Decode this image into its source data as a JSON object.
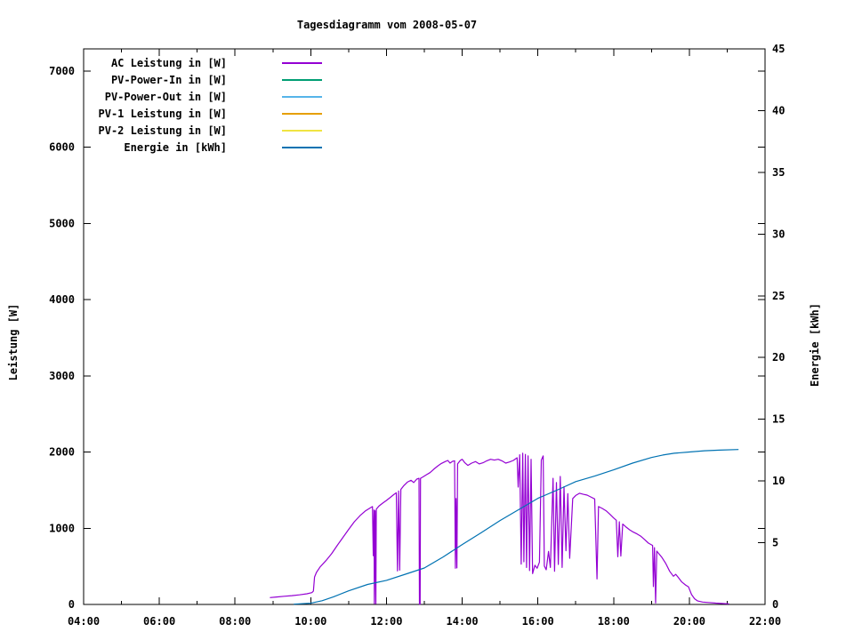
{
  "chart_data": {
    "type": "line",
    "title": "Tagesdiagramm vom 2008-05-07",
    "grid": false,
    "legend_position": "top-left",
    "x_axis": {
      "start_hour": 4,
      "end_hour": 22,
      "major_ticks": [
        {
          "hour": 4,
          "label": "04:00"
        },
        {
          "hour": 6,
          "label": "06:00"
        },
        {
          "hour": 8,
          "label": "08:00"
        },
        {
          "hour": 10,
          "label": "10:00"
        },
        {
          "hour": 12,
          "label": "12:00"
        },
        {
          "hour": 14,
          "label": "14:00"
        },
        {
          "hour": 16,
          "label": "16:00"
        },
        {
          "hour": 18,
          "label": "18:00"
        },
        {
          "hour": 20,
          "label": "20:00"
        },
        {
          "hour": 22,
          "label": "22:00"
        }
      ],
      "minor_tick_hours": [
        5,
        7,
        9,
        11,
        13,
        15,
        17,
        19,
        21
      ]
    },
    "y_left": {
      "label": "Leistung [W]",
      "ylim": [
        0,
        7292
      ],
      "tick_values": [
        0,
        1000,
        2000,
        3000,
        4000,
        5000,
        6000,
        7000
      ]
    },
    "y_right": {
      "label": "Energie [kWh]",
      "ylim": [
        0,
        45
      ],
      "tick_values": [
        0,
        5,
        10,
        15,
        20,
        25,
        30,
        35,
        40,
        45
      ]
    },
    "series": [
      {
        "name": "AC Leistung in [W]",
        "axis": "left",
        "color": "#9400d3",
        "points": [
          [
            8.92,
            90
          ],
          [
            9.1,
            98
          ],
          [
            9.3,
            107
          ],
          [
            9.5,
            116
          ],
          [
            9.7,
            126
          ],
          [
            9.9,
            140
          ],
          [
            10.03,
            155
          ],
          [
            10.07,
            175
          ],
          [
            10.1,
            360
          ],
          [
            10.15,
            420
          ],
          [
            10.25,
            495
          ],
          [
            10.4,
            575
          ],
          [
            10.55,
            665
          ],
          [
            10.7,
            775
          ],
          [
            10.85,
            880
          ],
          [
            11.0,
            985
          ],
          [
            11.15,
            1085
          ],
          [
            11.3,
            1165
          ],
          [
            11.45,
            1230
          ],
          [
            11.58,
            1270
          ],
          [
            11.63,
            1285
          ],
          [
            11.65,
            640
          ],
          [
            11.67,
            1240
          ],
          [
            11.68,
            10
          ],
          [
            11.7,
            1230
          ],
          [
            11.72,
            10
          ],
          [
            11.73,
            1250
          ],
          [
            11.8,
            1290
          ],
          [
            11.9,
            1330
          ],
          [
            12.0,
            1365
          ],
          [
            12.1,
            1405
          ],
          [
            12.2,
            1445
          ],
          [
            12.26,
            1465
          ],
          [
            12.29,
            440
          ],
          [
            12.32,
            1490
          ],
          [
            12.35,
            450
          ],
          [
            12.38,
            1510
          ],
          [
            12.45,
            1555
          ],
          [
            12.55,
            1605
          ],
          [
            12.65,
            1630
          ],
          [
            12.72,
            1600
          ],
          [
            12.8,
            1645
          ],
          [
            12.86,
            1655
          ],
          [
            12.87,
            5
          ],
          [
            12.89,
            5
          ],
          [
            12.9,
            1655
          ],
          [
            12.97,
            1675
          ],
          [
            13.05,
            1700
          ],
          [
            13.15,
            1730
          ],
          [
            13.25,
            1775
          ],
          [
            13.35,
            1815
          ],
          [
            13.45,
            1850
          ],
          [
            13.55,
            1875
          ],
          [
            13.62,
            1890
          ],
          [
            13.68,
            1855
          ],
          [
            13.75,
            1880
          ],
          [
            13.8,
            1885
          ],
          [
            13.82,
            475
          ],
          [
            13.84,
            1390
          ],
          [
            13.86,
            480
          ],
          [
            13.88,
            1845
          ],
          [
            13.95,
            1890
          ],
          [
            14.0,
            1905
          ],
          [
            14.07,
            1860
          ],
          [
            14.15,
            1825
          ],
          [
            14.25,
            1855
          ],
          [
            14.35,
            1875
          ],
          [
            14.45,
            1845
          ],
          [
            14.55,
            1860
          ],
          [
            14.65,
            1885
          ],
          [
            14.75,
            1905
          ],
          [
            14.85,
            1895
          ],
          [
            14.95,
            1905
          ],
          [
            15.05,
            1885
          ],
          [
            15.15,
            1855
          ],
          [
            15.25,
            1870
          ],
          [
            15.35,
            1890
          ],
          [
            15.45,
            1925
          ],
          [
            15.48,
            1540
          ],
          [
            15.52,
            1965
          ],
          [
            15.56,
            530
          ],
          [
            15.6,
            1985
          ],
          [
            15.63,
            560
          ],
          [
            15.67,
            1970
          ],
          [
            15.7,
            485
          ],
          [
            15.74,
            1950
          ],
          [
            15.78,
            445
          ],
          [
            15.82,
            1905
          ],
          [
            15.86,
            405
          ],
          [
            15.92,
            515
          ],
          [
            15.98,
            475
          ],
          [
            16.04,
            555
          ],
          [
            16.09,
            1895
          ],
          [
            16.14,
            1950
          ],
          [
            16.17,
            505
          ],
          [
            16.22,
            455
          ],
          [
            16.28,
            695
          ],
          [
            16.33,
            485
          ],
          [
            16.4,
            1655
          ],
          [
            16.44,
            435
          ],
          [
            16.49,
            1600
          ],
          [
            16.54,
            525
          ],
          [
            16.59,
            1680
          ],
          [
            16.64,
            485
          ],
          [
            16.69,
            1545
          ],
          [
            16.74,
            705
          ],
          [
            16.79,
            1455
          ],
          [
            16.84,
            605
          ],
          [
            16.92,
            1390
          ],
          [
            17.0,
            1430
          ],
          [
            17.1,
            1460
          ],
          [
            17.2,
            1445
          ],
          [
            17.3,
            1435
          ],
          [
            17.4,
            1410
          ],
          [
            17.5,
            1385
          ],
          [
            17.56,
            335
          ],
          [
            17.6,
            1285
          ],
          [
            17.7,
            1260
          ],
          [
            17.8,
            1230
          ],
          [
            17.9,
            1185
          ],
          [
            18.0,
            1135
          ],
          [
            18.07,
            1105
          ],
          [
            18.11,
            625
          ],
          [
            18.15,
            1085
          ],
          [
            18.19,
            635
          ],
          [
            18.24,
            1055
          ],
          [
            18.32,
            1020
          ],
          [
            18.42,
            980
          ],
          [
            18.52,
            950
          ],
          [
            18.62,
            925
          ],
          [
            18.72,
            895
          ],
          [
            18.82,
            850
          ],
          [
            18.92,
            805
          ],
          [
            19.03,
            775
          ],
          [
            19.05,
            235
          ],
          [
            19.08,
            745
          ],
          [
            19.11,
            20
          ],
          [
            19.14,
            700
          ],
          [
            19.18,
            675
          ],
          [
            19.28,
            615
          ],
          [
            19.38,
            535
          ],
          [
            19.48,
            435
          ],
          [
            19.58,
            370
          ],
          [
            19.64,
            395
          ],
          [
            19.7,
            360
          ],
          [
            19.8,
            295
          ],
          [
            19.9,
            255
          ],
          [
            19.98,
            230
          ],
          [
            20.06,
            130
          ],
          [
            20.14,
            75
          ],
          [
            20.22,
            45
          ],
          [
            20.35,
            32
          ],
          [
            20.5,
            26
          ],
          [
            20.7,
            18
          ],
          [
            20.9,
            12
          ],
          [
            21.05,
            8
          ]
        ]
      },
      {
        "name": "PV-Power-In in [W]",
        "axis": "left",
        "color": "#009e73",
        "points": []
      },
      {
        "name": "PV-Power-Out in [W]",
        "axis": "left",
        "color": "#56b4e9",
        "points": []
      },
      {
        "name": "PV-1 Leistung in [W]",
        "axis": "left",
        "color": "#e69f00",
        "points": []
      },
      {
        "name": "PV-2 Leistung in [W]",
        "axis": "left",
        "color": "#f0e442",
        "points": []
      },
      {
        "name": "Energie in [kWh]",
        "axis": "right",
        "color": "#0072b2",
        "points": [
          [
            9.55,
            0.02
          ],
          [
            10.0,
            0.1
          ],
          [
            10.3,
            0.3
          ],
          [
            10.6,
            0.62
          ],
          [
            11.0,
            1.1
          ],
          [
            11.5,
            1.62
          ],
          [
            12.0,
            1.95
          ],
          [
            12.5,
            2.45
          ],
          [
            13.0,
            2.95
          ],
          [
            13.5,
            3.85
          ],
          [
            14.0,
            4.85
          ],
          [
            14.5,
            5.8
          ],
          [
            15.0,
            6.8
          ],
          [
            15.5,
            7.7
          ],
          [
            16.0,
            8.6
          ],
          [
            16.5,
            9.25
          ],
          [
            17.0,
            9.95
          ],
          [
            17.5,
            10.4
          ],
          [
            18.0,
            10.9
          ],
          [
            18.5,
            11.45
          ],
          [
            19.0,
            11.9
          ],
          [
            19.3,
            12.1
          ],
          [
            19.6,
            12.25
          ],
          [
            20.0,
            12.35
          ],
          [
            20.4,
            12.45
          ],
          [
            20.8,
            12.5
          ],
          [
            21.3,
            12.55
          ]
        ]
      }
    ]
  }
}
